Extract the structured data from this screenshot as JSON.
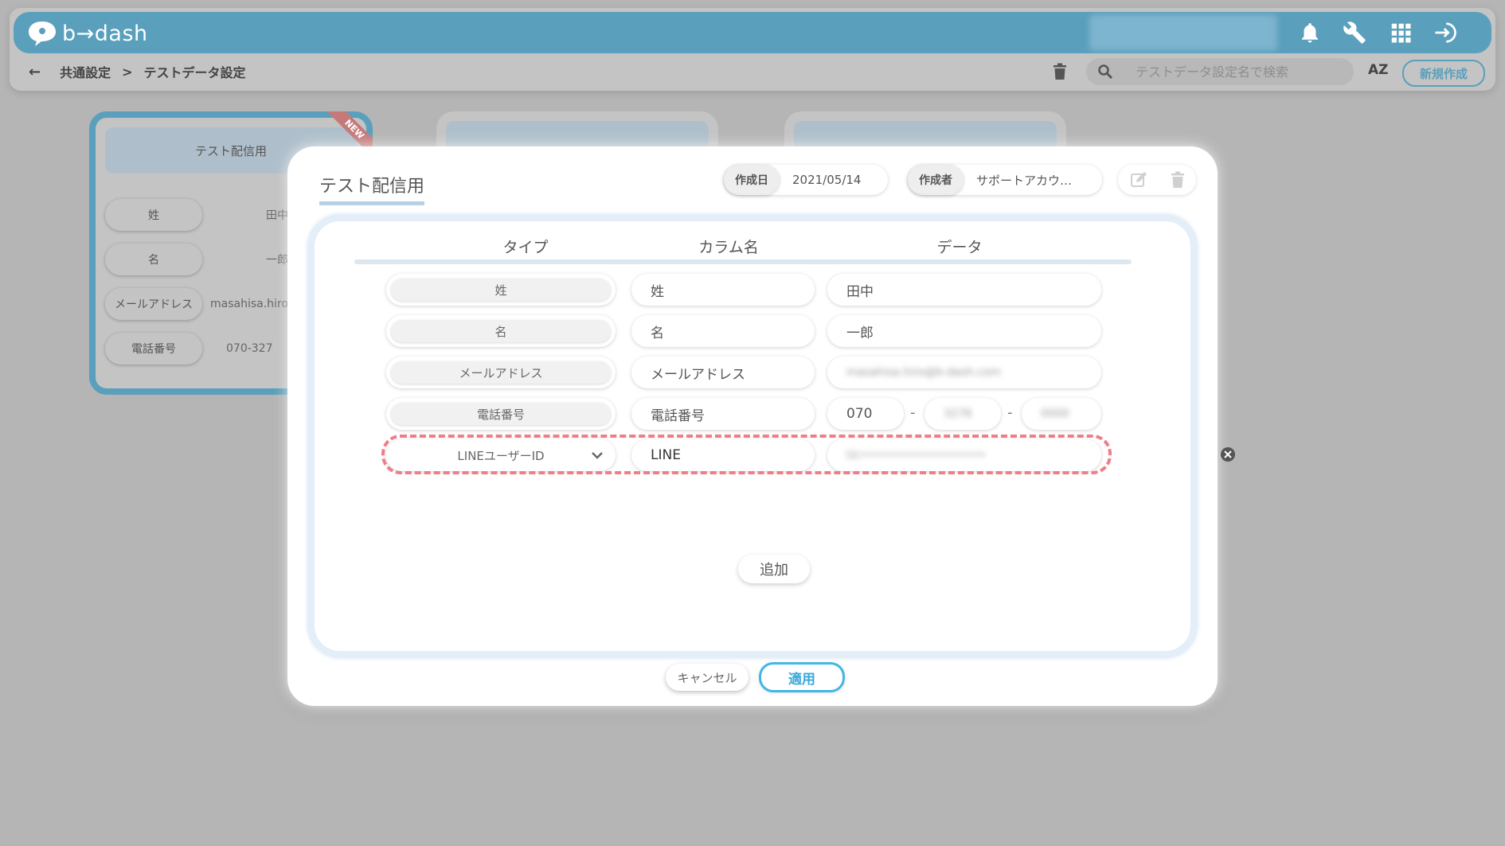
{
  "app": {
    "logo_text": "b→dash"
  },
  "header": {
    "icons": [
      "bell-icon",
      "wrench-icon",
      "apps-grid-icon",
      "logout-icon"
    ],
    "breadcrumb": {
      "parent": "共通設定",
      "separator": ">",
      "current": "テストデータ設定"
    },
    "search_placeholder": "テストデータ設定名で検索",
    "sort_label": "AZ",
    "new_button": "新規作成"
  },
  "background_card": {
    "title": "テスト配信用",
    "badge": "NEW",
    "rows": [
      {
        "label": "姓",
        "value": "田中"
      },
      {
        "label": "名",
        "value": "一郎"
      },
      {
        "label": "メールアドレス",
        "value": "masahisa.hiro"
      },
      {
        "label": "電話番号",
        "value": "070-327"
      }
    ]
  },
  "modal": {
    "title": "テスト配信用",
    "created_date_label": "作成日",
    "created_date": "2021/05/14",
    "author_label": "作成者",
    "author": "サポートアカウ…",
    "columns": {
      "type": "タイプ",
      "column_name": "カラム名",
      "data": "データ"
    },
    "rows": [
      {
        "type": "姓",
        "column_name": "姓",
        "data": "田中"
      },
      {
        "type": "名",
        "column_name": "名",
        "data": "一郎"
      },
      {
        "type": "メールアドレス",
        "column_name": "メールアドレス",
        "data": "masahisa.hiro@b-dash.com"
      },
      {
        "type": "電話番号",
        "column_name": "電話番号",
        "phone": [
          "070",
          "3276",
          "0000"
        ],
        "phone_sep": "-"
      },
      {
        "type": "LINEユーザーID",
        "column_name": "LINE",
        "data": "Uc•••••••••••••••••••"
      }
    ],
    "add_button": "追加",
    "cancel_button": "キャンセル",
    "apply_button": "適用",
    "highlight_color": "#f07d87",
    "accent_color": "#42b6e6"
  }
}
